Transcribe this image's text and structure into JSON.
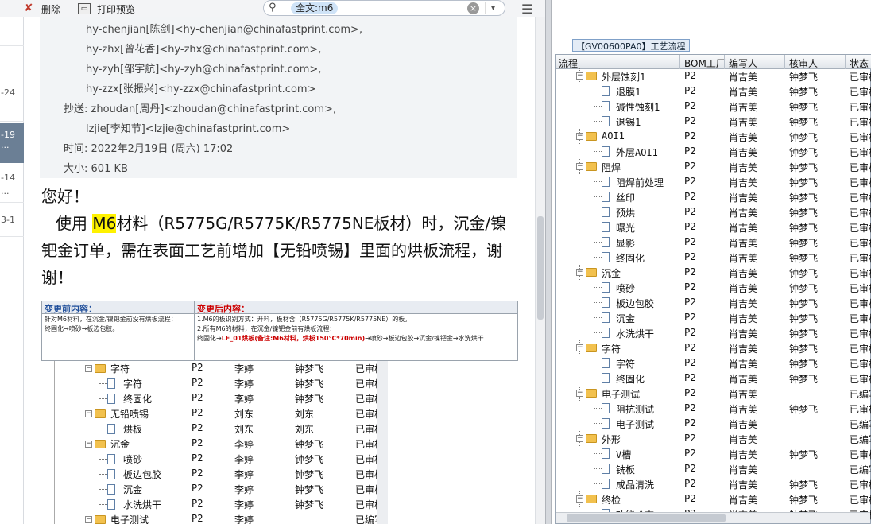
{
  "toolbar": {
    "delete_label": "删除",
    "print_label": "打印预览",
    "search_chip": "全文:m6"
  },
  "mail_list": {
    "dates": [
      "-24",
      "-19",
      "-14",
      "3-1"
    ],
    "selected_extra": "..."
  },
  "mail": {
    "to_lines": [
      "hy-chenjian[陈剑]<hy-chenjian@chinafastprint.com>,",
      "hy-zhx[曾花香]<hy-zhx@chinafastprint.com>,",
      "hy-zyh[邹宇航]<hy-zyh@chinafastprint.com>,",
      "hy-zzx[张振兴]<hy-zzx@chinafastprint.com>"
    ],
    "cc_label": "抄送:",
    "cc_lines": [
      "zhoudan[周丹]<zhoudan@chinafastprint.com>,",
      "lzjie[李知节]<lzjie@chinafastprint.com>"
    ],
    "time_label": "时间:",
    "time_value": "2022年2月19日 (周六) 17:02",
    "size_label": "大小:",
    "size_value": "601 KB",
    "greeting": "您好！",
    "body_pre": "使用 ",
    "body_highlight": "M6",
    "body_post": "材料（R5775G/R5775K/R5775NE板材）时，沉金/镍钯金订单，需在表面工艺前增加【无铅喷锡】里面的烘板流程，谢谢！"
  },
  "embedded": {
    "before_title": "变更前内容：",
    "before_text_1": "针对M6材料，在沉金/镍钯金前没有烘板流程：",
    "before_text_2": "终固化→喷砂→板边包胶。",
    "after_title": "变更后内容：",
    "after_text_1": "1.M6的板识别方式：开料，板材含（R5775G/R5775K/R5775NE）的板。",
    "after_text_2": "2.所有M6的材料，在沉金/镍钯金前有烘板流程：",
    "after_text_3a": "终固化→",
    "after_text_3b": "LF_01烘板(备注:M6材料，烘板150°C*70min)",
    "after_text_3c": "→喷砂→板边包胶→沉金/镍钯金→水洗烘干",
    "rows": [
      {
        "name": "字符",
        "bom": "P2",
        "writer": "李婷",
        "reviewer": "钟梦飞",
        "status": "已审核",
        "folder": true
      },
      {
        "name": "字符",
        "bom": "P2",
        "writer": "李婷",
        "reviewer": "钟梦飞",
        "status": "已审核",
        "folder": false
      },
      {
        "name": "终固化",
        "bom": "P2",
        "writer": "李婷",
        "reviewer": "钟梦飞",
        "status": "已审核",
        "folder": false
      },
      {
        "name": "无铅喷锡",
        "bom": "P2",
        "writer": "刘东",
        "reviewer": "刘东",
        "status": "已审核",
        "folder": true
      },
      {
        "name": "烘板",
        "bom": "P2",
        "writer": "刘东",
        "reviewer": "刘东",
        "status": "已审核",
        "folder": false
      },
      {
        "name": "沉金",
        "bom": "P2",
        "writer": "李婷",
        "reviewer": "钟梦飞",
        "status": "已审核",
        "folder": true
      },
      {
        "name": "喷砂",
        "bom": "P2",
        "writer": "李婷",
        "reviewer": "钟梦飞",
        "status": "已审核",
        "folder": false
      },
      {
        "name": "板边包胶",
        "bom": "P2",
        "writer": "李婷",
        "reviewer": "钟梦飞",
        "status": "已审核",
        "folder": false
      },
      {
        "name": "沉金",
        "bom": "P2",
        "writer": "李婷",
        "reviewer": "钟梦飞",
        "status": "已审核",
        "folder": false
      },
      {
        "name": "水洗烘干",
        "bom": "P2",
        "writer": "李婷",
        "reviewer": "钟梦飞",
        "status": "已审核",
        "folder": false
      },
      {
        "name": "电子测试",
        "bom": "P2",
        "writer": "李婷",
        "reviewer": "",
        "status": "已编写",
        "folder": true
      }
    ]
  },
  "right": {
    "title": "【GV00600PA0】工艺流程",
    "columns": [
      "流程",
      "BOM工厂",
      "编写人",
      "核审人",
      "状态"
    ],
    "rows": [
      {
        "name": "外层蚀刻1",
        "bom": "P2",
        "writer": "肖吉美",
        "reviewer": "钟梦飞",
        "status": "已审核",
        "folder": true
      },
      {
        "name": "退膜1",
        "bom": "P2",
        "writer": "肖吉美",
        "reviewer": "钟梦飞",
        "status": "已审核",
        "folder": false
      },
      {
        "name": "碱性蚀刻1",
        "bom": "P2",
        "writer": "肖吉美",
        "reviewer": "钟梦飞",
        "status": "已审核",
        "folder": false
      },
      {
        "name": "退锡1",
        "bom": "P2",
        "writer": "肖吉美",
        "reviewer": "钟梦飞",
        "status": "已审核",
        "folder": false
      },
      {
        "name": "AOI1",
        "bom": "P2",
        "writer": "肖吉美",
        "reviewer": "钟梦飞",
        "status": "已审核",
        "folder": true
      },
      {
        "name": "外层AOI1",
        "bom": "P2",
        "writer": "肖吉美",
        "reviewer": "钟梦飞",
        "status": "已审核",
        "folder": false
      },
      {
        "name": "阻焊",
        "bom": "P2",
        "writer": "肖吉美",
        "reviewer": "钟梦飞",
        "status": "已审核",
        "folder": true
      },
      {
        "name": "阻焊前处理",
        "bom": "P2",
        "writer": "肖吉美",
        "reviewer": "钟梦飞",
        "status": "已审核",
        "folder": false
      },
      {
        "name": "丝印",
        "bom": "P2",
        "writer": "肖吉美",
        "reviewer": "钟梦飞",
        "status": "已审核",
        "folder": false
      },
      {
        "name": "预烘",
        "bom": "P2",
        "writer": "肖吉美",
        "reviewer": "钟梦飞",
        "status": "已审核",
        "folder": false
      },
      {
        "name": "曝光",
        "bom": "P2",
        "writer": "肖吉美",
        "reviewer": "钟梦飞",
        "status": "已审核",
        "folder": false
      },
      {
        "name": "显影",
        "bom": "P2",
        "writer": "肖吉美",
        "reviewer": "钟梦飞",
        "status": "已审核",
        "folder": false
      },
      {
        "name": "终固化",
        "bom": "P2",
        "writer": "肖吉美",
        "reviewer": "钟梦飞",
        "status": "已审核",
        "folder": false
      },
      {
        "name": "沉金",
        "bom": "P2",
        "writer": "肖吉美",
        "reviewer": "钟梦飞",
        "status": "已审核",
        "folder": true
      },
      {
        "name": "喷砂",
        "bom": "P2",
        "writer": "肖吉美",
        "reviewer": "钟梦飞",
        "status": "已审核",
        "folder": false
      },
      {
        "name": "板边包胶",
        "bom": "P2",
        "writer": "肖吉美",
        "reviewer": "钟梦飞",
        "status": "已审核",
        "folder": false
      },
      {
        "name": "沉金",
        "bom": "P2",
        "writer": "肖吉美",
        "reviewer": "钟梦飞",
        "status": "已审核",
        "folder": false
      },
      {
        "name": "水洗烘干",
        "bom": "P2",
        "writer": "肖吉美",
        "reviewer": "钟梦飞",
        "status": "已审核",
        "folder": false
      },
      {
        "name": "字符",
        "bom": "P2",
        "writer": "肖吉美",
        "reviewer": "钟梦飞",
        "status": "已审核",
        "folder": true
      },
      {
        "name": "字符",
        "bom": "P2",
        "writer": "肖吉美",
        "reviewer": "钟梦飞",
        "status": "已审核",
        "folder": false
      },
      {
        "name": "终固化",
        "bom": "P2",
        "writer": "肖吉美",
        "reviewer": "钟梦飞",
        "status": "已审核",
        "folder": false
      },
      {
        "name": "电子测试",
        "bom": "P2",
        "writer": "肖吉美",
        "reviewer": "",
        "status": "已编写",
        "folder": true
      },
      {
        "name": "阻抗测试",
        "bom": "P2",
        "writer": "肖吉美",
        "reviewer": "钟梦飞",
        "status": "已审核",
        "folder": false
      },
      {
        "name": "电子测试",
        "bom": "P2",
        "writer": "肖吉美",
        "reviewer": "",
        "status": "已编写",
        "folder": false
      },
      {
        "name": "外形",
        "bom": "P2",
        "writer": "肖吉美",
        "reviewer": "",
        "status": "已编写",
        "folder": true
      },
      {
        "name": "V槽",
        "bom": "P2",
        "writer": "肖吉美",
        "reviewer": "钟梦飞",
        "status": "已审核",
        "folder": false
      },
      {
        "name": "铣板",
        "bom": "P2",
        "writer": "肖吉美",
        "reviewer": "",
        "status": "已编写",
        "folder": false
      },
      {
        "name": "成品清洗",
        "bom": "P2",
        "writer": "肖吉美",
        "reviewer": "钟梦飞",
        "status": "已审核",
        "folder": false
      },
      {
        "name": "终检",
        "bom": "P2",
        "writer": "肖吉美",
        "reviewer": "钟梦飞",
        "status": "已审核",
        "folder": true
      },
      {
        "name": "功能检查",
        "bom": "P2",
        "writer": "肖吉美",
        "reviewer": "钟梦飞",
        "status": "已审核",
        "folder": false
      }
    ]
  }
}
